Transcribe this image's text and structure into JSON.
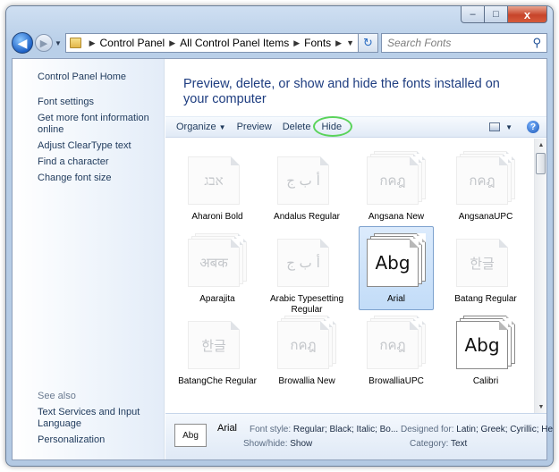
{
  "window": {
    "minimize_glyph": "–",
    "maximize_glyph": "□",
    "close_glyph": "x"
  },
  "nav": {
    "back_glyph": "◀",
    "forward_glyph": "▶",
    "breadcrumb": [
      "Control Panel",
      "All Control Panel Items",
      "Fonts"
    ],
    "refresh_glyph": "↻",
    "search_placeholder": "Search Fonts",
    "search_value": ""
  },
  "sidebar": {
    "home": "Control Panel Home",
    "links": [
      "Font settings",
      "Get more font information online",
      "Adjust ClearType text",
      "Find a character",
      "Change font size"
    ],
    "see_also": "See also",
    "see_also_links": [
      "Text Services and Input Language",
      "Personalization"
    ]
  },
  "main": {
    "heading": "Preview, delete, or show and hide the fonts installed on your computer",
    "commands": {
      "organize": "Organize",
      "preview": "Preview",
      "delete": "Delete",
      "hide": "Hide"
    },
    "help_glyph": "?"
  },
  "fonts": [
    {
      "name": "Aharoni Bold",
      "sample": "אבג",
      "stack": 1,
      "hidden": true,
      "selected": false
    },
    {
      "name": "Andalus Regular",
      "sample": "أ ب ج",
      "stack": 1,
      "hidden": true,
      "selected": false
    },
    {
      "name": "Angsana New",
      "sample": "กคฎ",
      "stack": 3,
      "hidden": true,
      "selected": false
    },
    {
      "name": "AngsanaUPC",
      "sample": "กคฎ",
      "stack": 3,
      "hidden": true,
      "selected": false
    },
    {
      "name": "Aparajita",
      "sample": "अबक",
      "stack": 3,
      "hidden": true,
      "selected": false
    },
    {
      "name": "Arabic Typesetting Regular",
      "sample": "أ ب ج",
      "stack": 1,
      "hidden": true,
      "selected": false
    },
    {
      "name": "Arial",
      "sample": "Abg",
      "stack": 3,
      "hidden": false,
      "selected": true
    },
    {
      "name": "Batang Regular",
      "sample": "한글",
      "stack": 1,
      "hidden": true,
      "selected": false
    },
    {
      "name": "BatangChe Regular",
      "sample": "한글",
      "stack": 1,
      "hidden": true,
      "selected": false
    },
    {
      "name": "Browallia New",
      "sample": "กคฎ",
      "stack": 3,
      "hidden": true,
      "selected": false
    },
    {
      "name": "BrowalliaUPC",
      "sample": "กคฎ",
      "stack": 3,
      "hidden": true,
      "selected": false
    },
    {
      "name": "Calibri",
      "sample": "Abg",
      "stack": 3,
      "hidden": false,
      "selected": false
    }
  ],
  "details": {
    "name": "Arial",
    "thumb_sample": "Abg",
    "font_style_label": "Font style:",
    "font_style_value": "Regular; Black; Italic; Bo...",
    "designed_for_label": "Designed for:",
    "designed_for_value": "Latin; Greek; Cyrillic; He...",
    "show_hide_label": "Show/hide:",
    "show_hide_value": "Show",
    "category_label": "Category:",
    "category_value": "Text"
  }
}
